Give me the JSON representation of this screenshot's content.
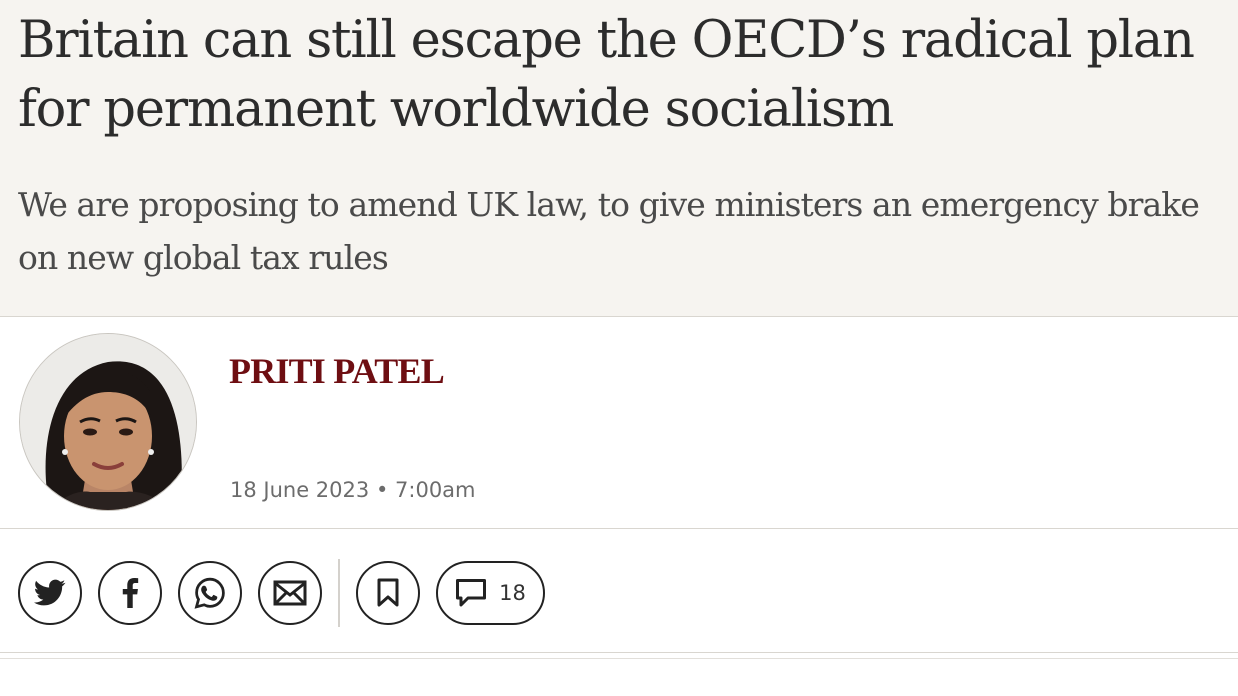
{
  "article": {
    "headline": "Britain can still escape the OECD’s radical plan for permanent worldwide socialism",
    "standfirst": "We are proposing to amend UK law, to give ministers an emergency brake on new global tax rules"
  },
  "byline": {
    "author": "PRITI PATEL",
    "date": "18 June 2023",
    "separator": "•",
    "time": "7:00am"
  },
  "share": {
    "buttons": [
      {
        "icon": "twitter-icon"
      },
      {
        "icon": "facebook-icon"
      },
      {
        "icon": "whatsapp-icon"
      },
      {
        "icon": "email-icon"
      },
      {
        "icon": "bookmark-icon"
      }
    ],
    "comments": {
      "icon": "comment-icon",
      "count": "18"
    }
  },
  "colors": {
    "header_background": "#f6f4f0",
    "author_color": "#6e0e12",
    "text": "#2c2c2c"
  }
}
